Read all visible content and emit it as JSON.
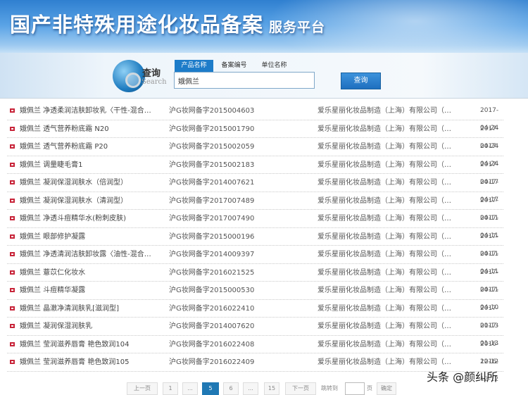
{
  "header": {
    "title": "国产非特殊用途化妆品备案",
    "subtitle": "服务平台"
  },
  "search": {
    "label": "查询",
    "label_en": "Search",
    "tabs": [
      {
        "label": "产品名称",
        "active": true
      },
      {
        "label": "备案编号"
      },
      {
        "label": "单位名称"
      }
    ],
    "value": "娥佩兰",
    "button": "查询"
  },
  "rows": [
    {
      "name": "娥佩兰 净透柔润洁肤卸妆乳〈干性-混合…",
      "no": "沪G妆网备字2015004603",
      "company": "爱乐星丽化妆品制造（上海）有限公司（…",
      "date": "2017-04-24"
    },
    {
      "name": "娥佩兰 透气营养粉底霜 N20",
      "no": "沪G妆网备字2015001790",
      "company": "爱乐星丽化妆品制造（上海）有限公司（…",
      "date": "2017-04-24"
    },
    {
      "name": "娥佩兰 透气营养粉底霜 P20",
      "no": "沪G妆网备字2015002059",
      "company": "爱乐星丽化妆品制造（上海）有限公司（…",
      "date": "2017-04-24"
    },
    {
      "name": "娥佩兰 调量睫毛膏1",
      "no": "沪G妆网备字2015002183",
      "company": "爱乐星丽化妆品制造（上海）有限公司（…",
      "date": "2017-04-17"
    },
    {
      "name": "娥佩兰 凝润保湿润肤水（倍润型）",
      "no": "沪G妆网备字2014007621",
      "company": "爱乐星丽化妆品制造（上海）有限公司（…",
      "date": "2017-04-17"
    },
    {
      "name": "娥佩兰 凝润保湿润肤水（清润型）",
      "no": "沪G妆网备字2017007489",
      "company": "爱乐星丽化妆品制造（上海）有限公司（…",
      "date": "2017-04-11"
    },
    {
      "name": "娥佩兰 净透斗痘精华水(粉刺皮肤)",
      "no": "沪G妆网备字2017007490",
      "company": "爱乐星丽化妆品制造（上海）有限公司（…",
      "date": "2017-04-11"
    },
    {
      "name": "娥佩兰 眼部修护凝露",
      "no": "沪G妆网备字2015000196",
      "company": "爱乐星丽化妆品制造（上海）有限公司（…",
      "date": "2017-04-11"
    },
    {
      "name": "娥佩兰 净透清润洁肤卸妆露〈油性-混合…",
      "no": "沪G妆网备字2014009397",
      "company": "爱乐星丽化妆品制造（上海）有限公司（…",
      "date": "2017-04-11"
    },
    {
      "name": "娥佩兰 薏苡仁化妆水",
      "no": "沪G妆网备字2016021525",
      "company": "爱乐星丽化妆品制造（上海）有限公司（…",
      "date": "2017-04-11"
    },
    {
      "name": "娥佩兰 斗痘精华凝露",
      "no": "沪G妆网备字2015000530",
      "company": "爱乐星丽化妆品制造（上海）有限公司（…",
      "date": "2017-04-10"
    },
    {
      "name": "娥佩兰 晶澈净清润肤乳[滋润型]",
      "no": "沪G妆网备字2016022410",
      "company": "爱乐星丽化妆品制造（上海）有限公司（…",
      "date": "2017-01-13"
    },
    {
      "name": "娥佩兰 凝润保湿润肤乳",
      "no": "沪G妆网备字2014007620",
      "company": "爱乐星丽化妆品制造（上海）有限公司（…",
      "date": "2017-01-13"
    },
    {
      "name": "娥佩兰 莹润滋养唇膏 艳色致润104",
      "no": "沪G妆网备字2016022408",
      "company": "爱乐星丽化妆品制造（上海）有限公司（…",
      "date": "2016-12-12"
    },
    {
      "name": "娥佩兰 莹润滋养唇膏 艳色致润105",
      "no": "沪G妆网备字2016022409",
      "company": "爱乐星丽化妆品制造（上海）有限公司（…",
      "date": "2016-12-12"
    }
  ],
  "pager": {
    "prev": "上一页",
    "p1": "1",
    "ellipsis": "...",
    "current": "5",
    "p6": "6",
    "last": "15",
    "next": "下一页",
    "jump": "跳转到",
    "page": "页",
    "ok": "确定"
  },
  "watermark": "头条 @颜纠所"
}
